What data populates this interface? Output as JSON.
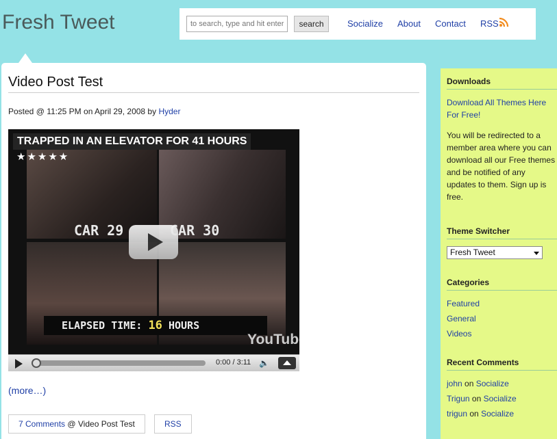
{
  "site": {
    "title": "Fresh Tweet"
  },
  "header": {
    "search_placeholder": "to search, type and hit enter",
    "search_button": "search",
    "nav": [
      "Socialize",
      "About",
      "Contact",
      "RSS"
    ]
  },
  "post": {
    "title": "Video Post Test",
    "meta_prefix": "Posted @ 11:25 PM on April 29, 2008 by",
    "author": "Hyder",
    "more_link": "(more…)",
    "comments_link": "7 Comments",
    "comments_suffix": "@ Video Post Test",
    "rss_label": "RSS"
  },
  "video": {
    "title": "TRAPPED IN AN ELEVATOR FOR 41 HOURS",
    "stars": "★★★★★",
    "cam_labels": [
      "CAR 29",
      "CAR 30"
    ],
    "elapsed_label": "ELAPSED TIME:",
    "elapsed_value": "16",
    "elapsed_unit": "HOURS",
    "logo": "YouTube",
    "timecode": "0:00 / 3:11"
  },
  "sidebar": {
    "downloads": {
      "heading": "Downloads",
      "link": "Download All Themes Here For Free!",
      "text": "You will be redirected to a member area where you can download all our Free themes and be notified of any updates to them. Sign up is free."
    },
    "theme_switcher": {
      "heading": "Theme Switcher",
      "selected": "Fresh Tweet"
    },
    "categories": {
      "heading": "Categories",
      "items": [
        "Featured",
        "General",
        "Videos"
      ]
    },
    "recent_comments": {
      "heading": "Recent Comments",
      "items": [
        {
          "author": "john",
          "on": "on",
          "post": "Socialize"
        },
        {
          "author": "Trigun",
          "on": "on",
          "post": "Socialize"
        },
        {
          "author": "trigun",
          "on": "on",
          "post": "Socialize"
        }
      ]
    }
  }
}
